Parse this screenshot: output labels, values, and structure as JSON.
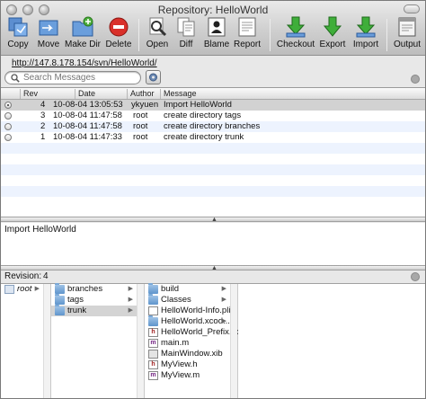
{
  "window": {
    "title": "Repository: HelloWorld"
  },
  "toolbar": {
    "copy": "Copy",
    "move": "Move",
    "make_dir": "Make Dir",
    "delete": "Delete",
    "open": "Open",
    "diff": "Diff",
    "blame": "Blame",
    "report": "Report",
    "checkout": "Checkout",
    "export": "Export",
    "import": "Import",
    "output": "Output"
  },
  "url": "http://147.8.178.154/svn/HelloWorld/",
  "search": {
    "placeholder": "Search Messages"
  },
  "log": {
    "headers": {
      "rev": "Rev",
      "date": "Date",
      "author": "Author",
      "message": "Message"
    },
    "rows": [
      {
        "rev": "4",
        "date": "10-08-04 13:05:53",
        "author": "ykyuen",
        "message": "Import HelloWorld"
      },
      {
        "rev": "3",
        "date": "10-08-04 11:47:58",
        "author": "root",
        "message": "create directory tags"
      },
      {
        "rev": "2",
        "date": "10-08-04 11:47:58",
        "author": "root",
        "message": "create directory branches"
      },
      {
        "rev": "1",
        "date": "10-08-04 11:47:33",
        "author": "root",
        "message": "create directory trunk"
      }
    ]
  },
  "message_text": "Import HelloWorld",
  "revision": {
    "label": "Revision:",
    "value": "4"
  },
  "browser": {
    "col1": [
      {
        "name": "root"
      }
    ],
    "col2": [
      {
        "name": "branches"
      },
      {
        "name": "tags"
      },
      {
        "name": "trunk"
      }
    ],
    "col3": [
      {
        "name": "build"
      },
      {
        "name": "Classes"
      }
    ],
    "col4": [
      {
        "name": "HelloWorld-Info.plist"
      },
      {
        "name": "HelloWorld.xcod..."
      },
      {
        "name": "HelloWorld_Prefix.pch"
      },
      {
        "name": "main.m"
      },
      {
        "name": "MainWindow.xib"
      },
      {
        "name": "MyView.h"
      },
      {
        "name": "MyView.m"
      }
    ]
  }
}
